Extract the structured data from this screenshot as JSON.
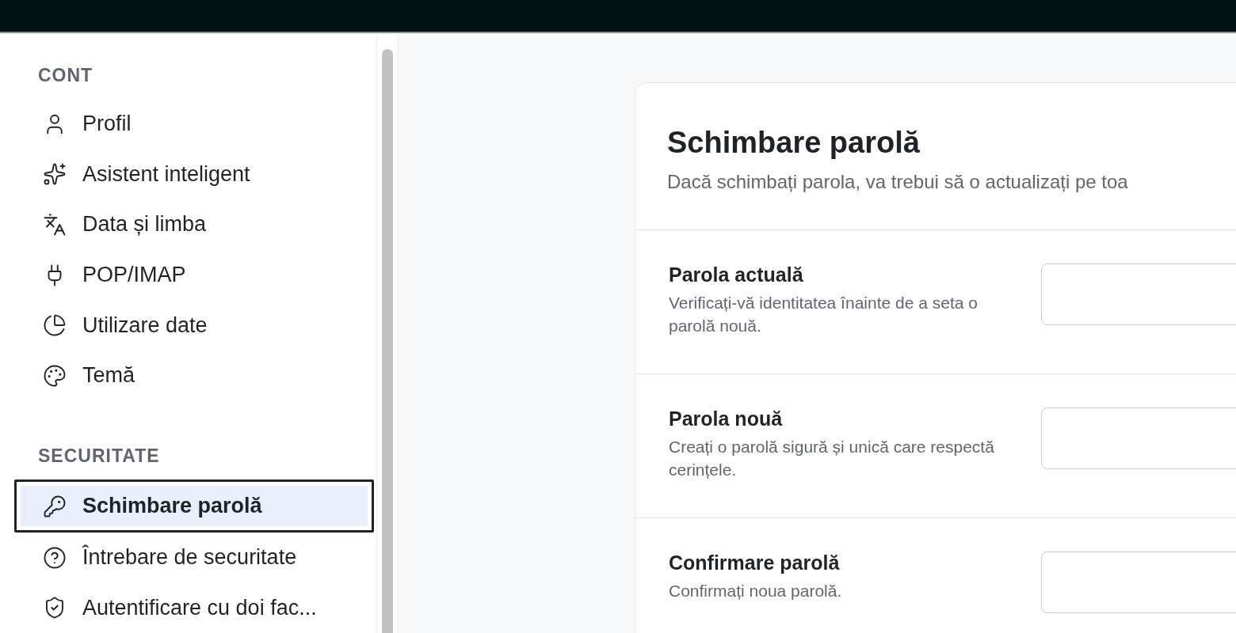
{
  "sidebar": {
    "sections": [
      {
        "title": "CONT",
        "items": [
          {
            "label": "Profil",
            "selected": false
          },
          {
            "label": "Asistent inteligent",
            "selected": false
          },
          {
            "label": "Data și limba",
            "selected": false
          },
          {
            "label": "POP/IMAP",
            "selected": false
          },
          {
            "label": "Utilizare date",
            "selected": false
          },
          {
            "label": "Temă",
            "selected": false
          }
        ]
      },
      {
        "title": "SECURITATE",
        "items": [
          {
            "label": "Schimbare parolă",
            "selected": true
          },
          {
            "label": "Întrebare de securitate",
            "selected": false
          },
          {
            "label": "Autentificare cu doi fac...",
            "selected": false
          }
        ]
      }
    ]
  },
  "card": {
    "title": "Schimbare parolă",
    "description": "Dacă schimbați parola, va trebui să o actualizați pe toa",
    "fields": [
      {
        "label": "Parola actuală",
        "hint": "Verificați-vă identitatea înainte de a seta o parolă nouă."
      },
      {
        "label": "Parola nouă",
        "hint": "Creați o parolă sigură și unică care respectă cerințele."
      },
      {
        "label": "Confirmare parolă",
        "hint": "Confirmați noua parolă."
      }
    ]
  }
}
